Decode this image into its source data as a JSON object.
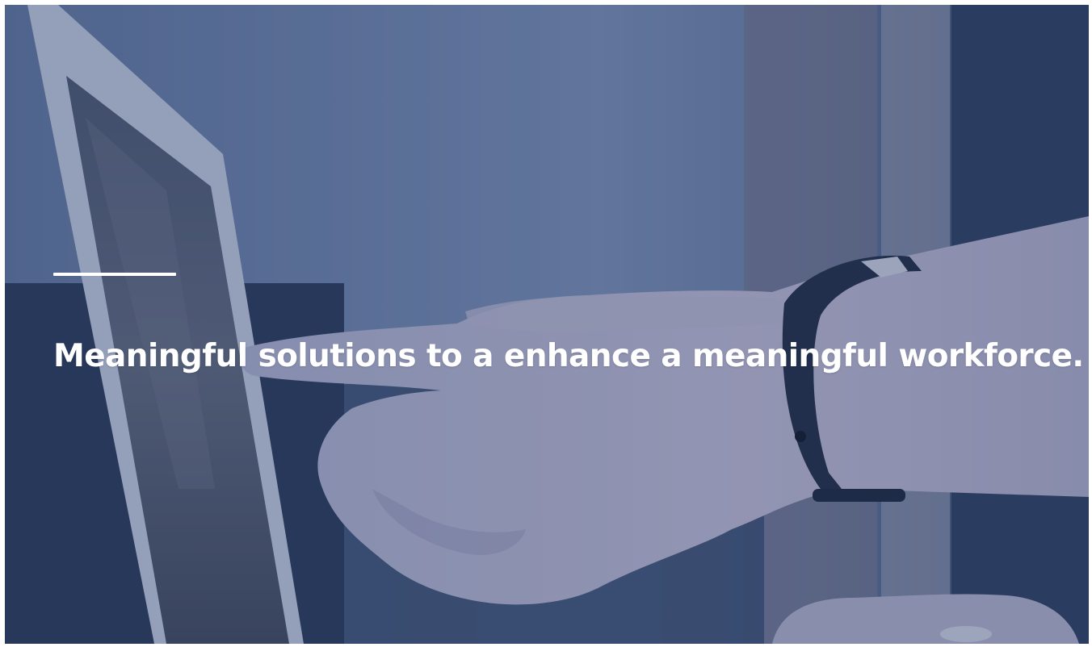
{
  "hero": {
    "headline": "Meaningful solutions to a enhance a meaningful workforce.",
    "background_image": "person pointing at laptop screen wearing fitness tracker",
    "overlay_color": "#4c6288",
    "text_color": "#ffffff"
  }
}
